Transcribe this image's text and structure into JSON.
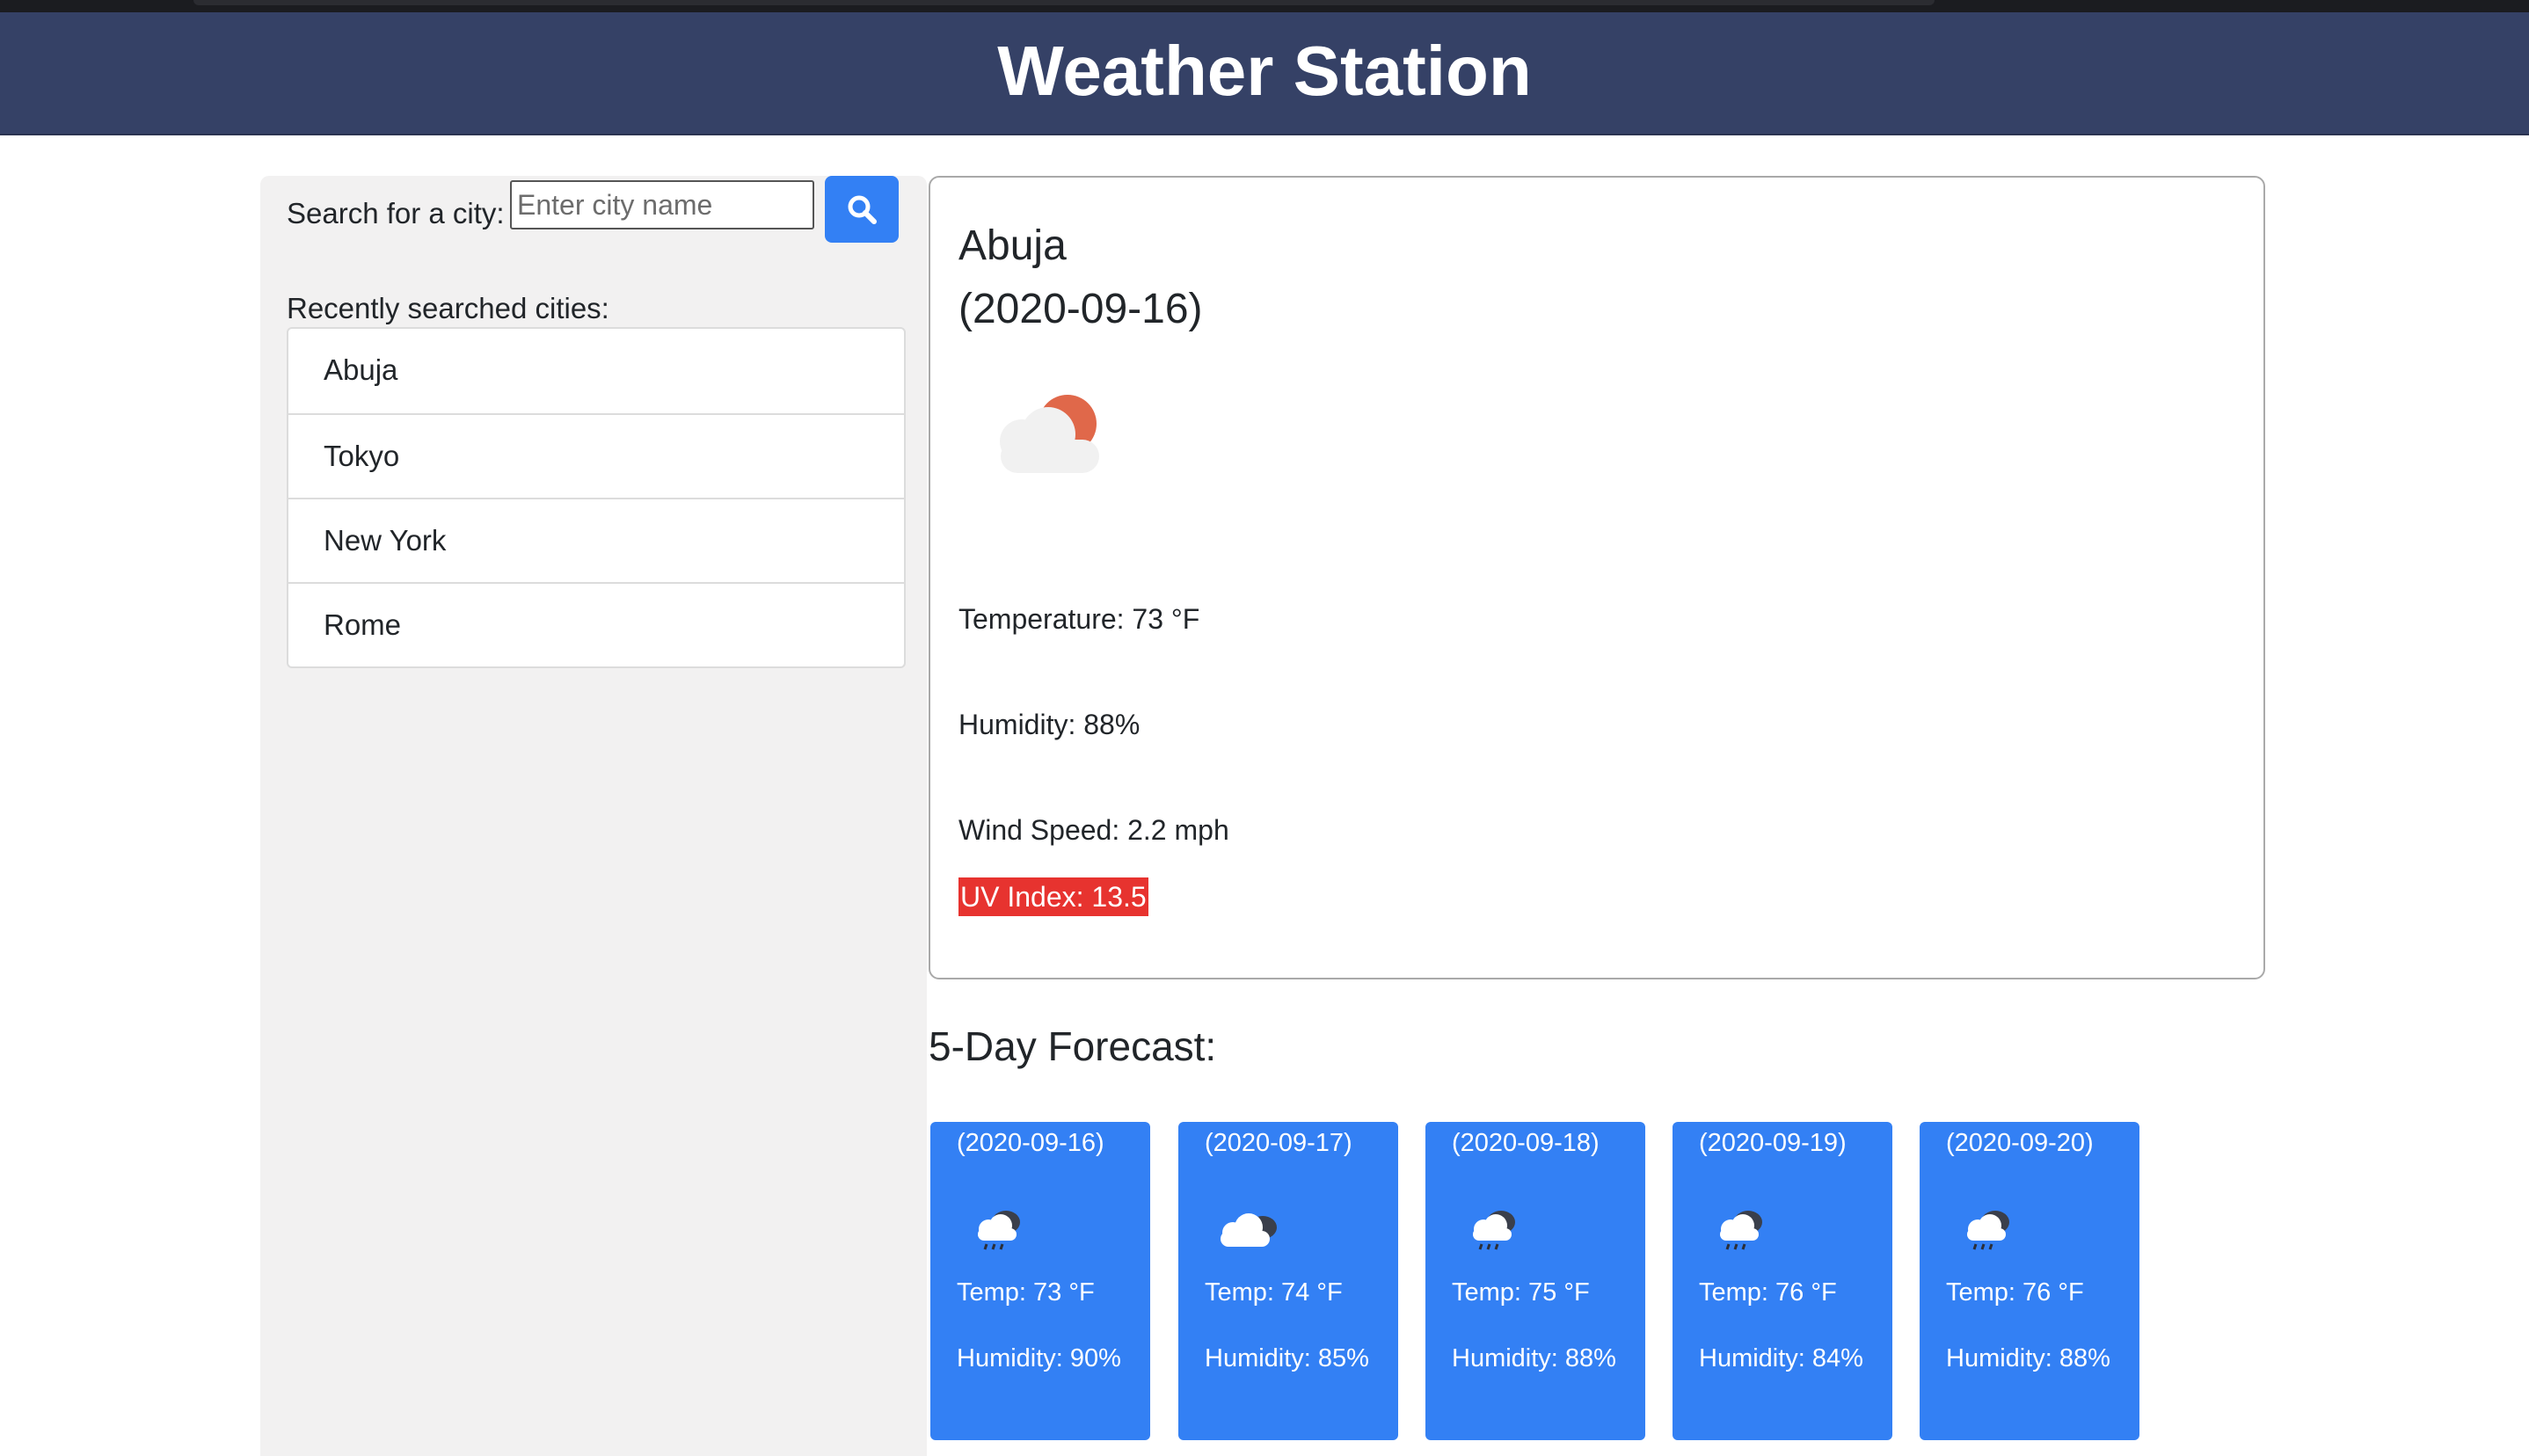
{
  "app": {
    "title": "Weather Station"
  },
  "colors": {
    "header": "#354166",
    "accent": "#3380f4",
    "uv_high": "#e7332f",
    "sidebar": "#f2f1f1"
  },
  "search": {
    "label": "Search for a city:",
    "placeholder": "Enter city name",
    "value": "",
    "button_icon": "search-icon"
  },
  "recent": {
    "label": "Recently searched cities:",
    "cities": [
      "Abuja",
      "Tokyo",
      "New York",
      "Rome"
    ]
  },
  "current": {
    "city": "Abuja",
    "date": "(2020-09-16)",
    "icon": "partly-cloudy-icon",
    "temperature": "Temperature: 73 °F",
    "humidity": "Humidity: 88%",
    "wind": "Wind Speed: 2.2 mph",
    "uv": "UV Index: 13.5"
  },
  "forecast": {
    "title": "5-Day Forecast:",
    "days": [
      {
        "date": "(2020-09-16)",
        "icon": "rain-cloud-icon",
        "temp": "Temp: 73 °F",
        "humidity": "Humidity: 90%"
      },
      {
        "date": "(2020-09-17)",
        "icon": "cloud-icon",
        "temp": "Temp: 74 °F",
        "humidity": "Humidity: 85%"
      },
      {
        "date": "(2020-09-18)",
        "icon": "rain-cloud-icon",
        "temp": "Temp: 75 °F",
        "humidity": "Humidity: 88%"
      },
      {
        "date": "(2020-09-19)",
        "icon": "rain-cloud-icon",
        "temp": "Temp: 76 °F",
        "humidity": "Humidity: 84%"
      },
      {
        "date": "(2020-09-20)",
        "icon": "rain-cloud-icon",
        "temp": "Temp: 76 °F",
        "humidity": "Humidity: 88%"
      }
    ]
  }
}
